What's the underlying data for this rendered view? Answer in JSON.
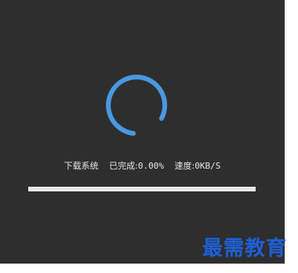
{
  "dialog": {
    "title_label": "下载系统",
    "completed_label": "已完成:",
    "completed_value": "0.00%",
    "speed_label": "速度:",
    "speed_value": "0KB/S",
    "progress_fraction": 0.0
  },
  "spinner": {
    "icon": "loading-spinner-icon",
    "color": "#4a98e2"
  },
  "watermark": {
    "text": "最需教育",
    "color": "#1e5fd6"
  },
  "colors": {
    "panel_bg": "#2e2e2e",
    "track": "#e8e8e8",
    "accent": "#4a98e2"
  }
}
